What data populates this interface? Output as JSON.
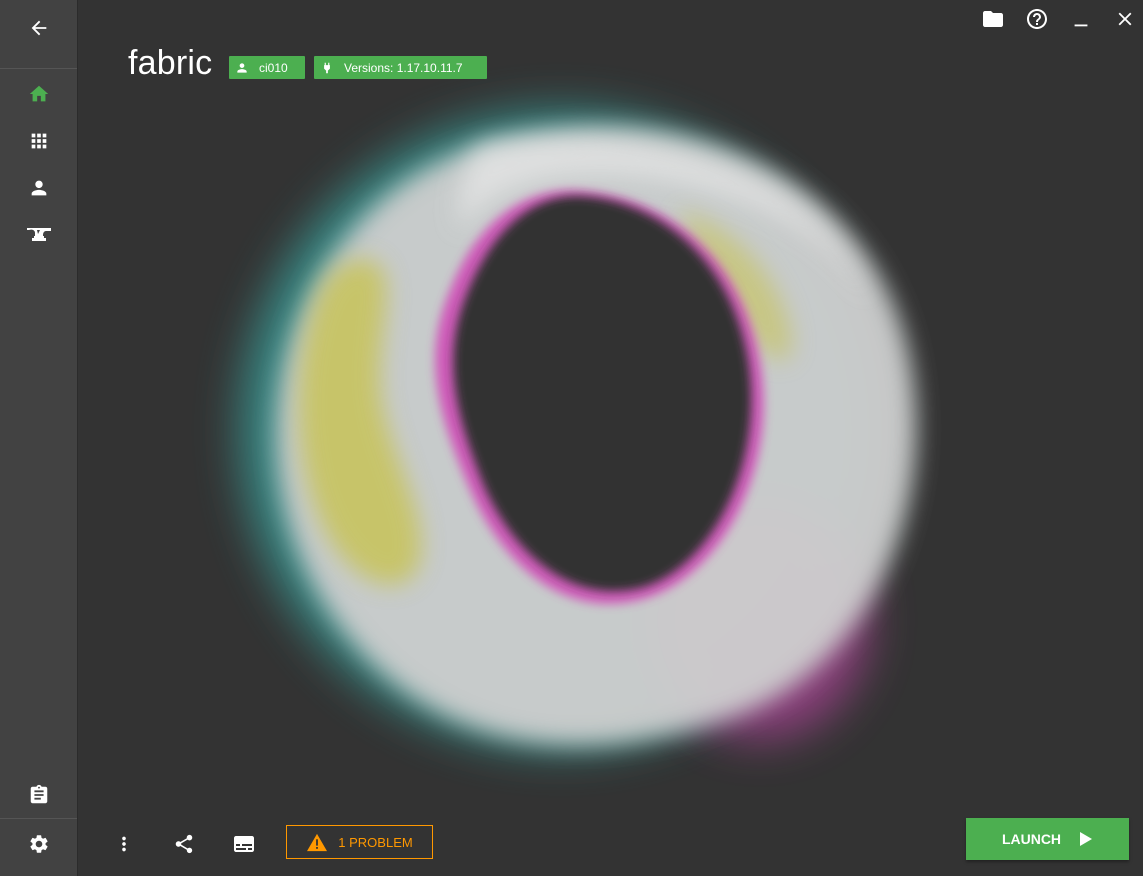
{
  "window": {
    "controls": [
      "folder-icon",
      "help-icon",
      "minimize-icon",
      "close-icon"
    ]
  },
  "sidebar": {
    "items": [
      {
        "name": "back-icon"
      },
      {
        "name": "home-icon",
        "active": true
      },
      {
        "name": "grid-icon"
      },
      {
        "name": "account-icon"
      },
      {
        "name": "anvil-icon"
      },
      {
        "name": "clipboard-icon"
      },
      {
        "name": "settings-icon"
      }
    ],
    "active_color": "#4caf50"
  },
  "header": {
    "title": "fabric",
    "user_badge": "ci010",
    "version_badge": "Versions: 1.17.10.11.7"
  },
  "footer": {
    "problem_label": "1 PROBLEM",
    "launch_label": "LAUNCH"
  },
  "colors": {
    "accent": "#4caf50",
    "warning": "#ff9800",
    "background": "#333333",
    "sidebar": "#424242"
  }
}
